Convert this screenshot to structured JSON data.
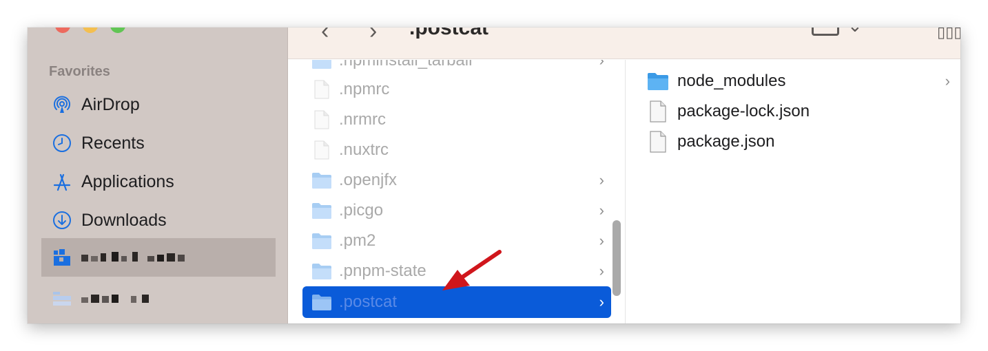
{
  "sidebar": {
    "heading": "Favorites",
    "items": [
      {
        "label": "AirDrop",
        "icon": "airdrop-icon"
      },
      {
        "label": "Recents",
        "icon": "clock-icon"
      },
      {
        "label": "Applications",
        "icon": "applications-icon"
      },
      {
        "label": "Downloads",
        "icon": "download-icon"
      }
    ]
  },
  "toolbar": {
    "back": "‹",
    "forward": "›",
    "title": ".postcat",
    "view_chevron": "⌄",
    "grid": "▯▯▯"
  },
  "column1": {
    "items": [
      {
        "name": ".npminstall_tarball",
        "type": "folder",
        "chevron": "›"
      },
      {
        "name": ".npmrc",
        "type": "file",
        "chevron": ""
      },
      {
        "name": ".nrmrc",
        "type": "file",
        "chevron": ""
      },
      {
        "name": ".nuxtrc",
        "type": "file",
        "chevron": ""
      },
      {
        "name": ".openjfx",
        "type": "folder",
        "chevron": "›"
      },
      {
        "name": ".picgo",
        "type": "folder",
        "chevron": "›"
      },
      {
        "name": ".pm2",
        "type": "folder",
        "chevron": "›"
      },
      {
        "name": ".pnpm-state",
        "type": "folder",
        "chevron": "›"
      },
      {
        "name": ".postcat",
        "type": "folder",
        "chevron": "›",
        "selected": true
      }
    ]
  },
  "column2": {
    "items": [
      {
        "name": "node_modules",
        "type": "folder",
        "chevron": "›"
      },
      {
        "name": "package-lock.json",
        "type": "file",
        "chevron": ""
      },
      {
        "name": "package.json",
        "type": "file",
        "chevron": ""
      }
    ]
  },
  "colors": {
    "sidebar_bg": "#d1c8c4",
    "accent_blue": "#1a6fe0",
    "selection_blue": "#0a5bd9",
    "annotation_red": "#d0161c"
  }
}
